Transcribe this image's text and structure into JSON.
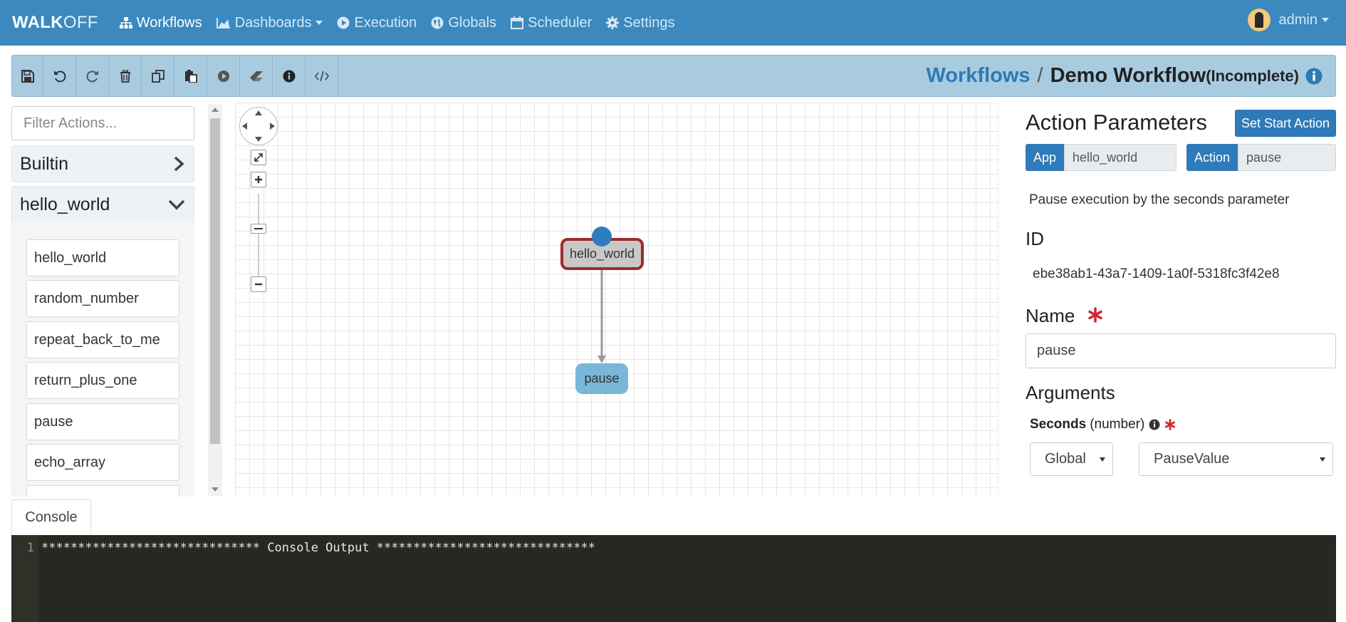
{
  "navbar": {
    "brand_bold": "WALK",
    "brand_light": "OFF",
    "items": [
      {
        "label": "Workflows",
        "icon": "sitemap-icon",
        "active": true
      },
      {
        "label": "Dashboards",
        "icon": "area-chart-icon",
        "dropdown": true
      },
      {
        "label": "Execution",
        "icon": "play-circle-icon"
      },
      {
        "label": "Globals",
        "icon": "globe-icon"
      },
      {
        "label": "Scheduler",
        "icon": "calendar-icon"
      },
      {
        "label": "Settings",
        "icon": "gear-icon"
      }
    ],
    "user": "admin"
  },
  "toolbar": {
    "buttons": [
      "save-icon",
      "undo-icon",
      "redo-icon",
      "trash-icon",
      "copy-icon",
      "paste-icon",
      "play-icon",
      "eraser-icon",
      "info-icon",
      "code-icon"
    ],
    "breadcrumb": {
      "root": "Workflows",
      "separator": "/",
      "name": "Demo Workflow",
      "status": "(Incomplete)"
    }
  },
  "left": {
    "filter_placeholder": "Filter Actions...",
    "groups": [
      {
        "label": "Builtin",
        "expanded": false
      },
      {
        "label": "hello_world",
        "expanded": true
      }
    ],
    "actions": [
      "hello_world",
      "random_number",
      "repeat_back_to_me",
      "return_plus_one",
      "pause",
      "echo_array"
    ]
  },
  "canvas": {
    "nodes": [
      {
        "label": "hello_world",
        "start": true
      },
      {
        "label": "pause",
        "selected": true
      }
    ]
  },
  "right": {
    "title": "Action Parameters",
    "set_start_button": "Set Start Action",
    "app_label": "App",
    "app_value": "hello_world",
    "action_label": "Action",
    "action_value": "pause",
    "description": "Pause execution by the seconds parameter",
    "id_label": "ID",
    "id_value": "ebe38ab1-43a7-1409-1a0f-5318fc3f42e8",
    "name_label": "Name",
    "name_value": "pause",
    "arguments_label": "Arguments",
    "arg": {
      "name": "Seconds",
      "type": "(number)",
      "source": "Global",
      "value": "PauseValue"
    }
  },
  "console": {
    "tab": "Console",
    "line_no": "1",
    "line": "****************************** Console Output ******************************"
  },
  "colors": {
    "primary": "#2f7ab8",
    "navbar": "#3b89be",
    "start_node": "#2f7dc0",
    "required": "#d0262e"
  }
}
